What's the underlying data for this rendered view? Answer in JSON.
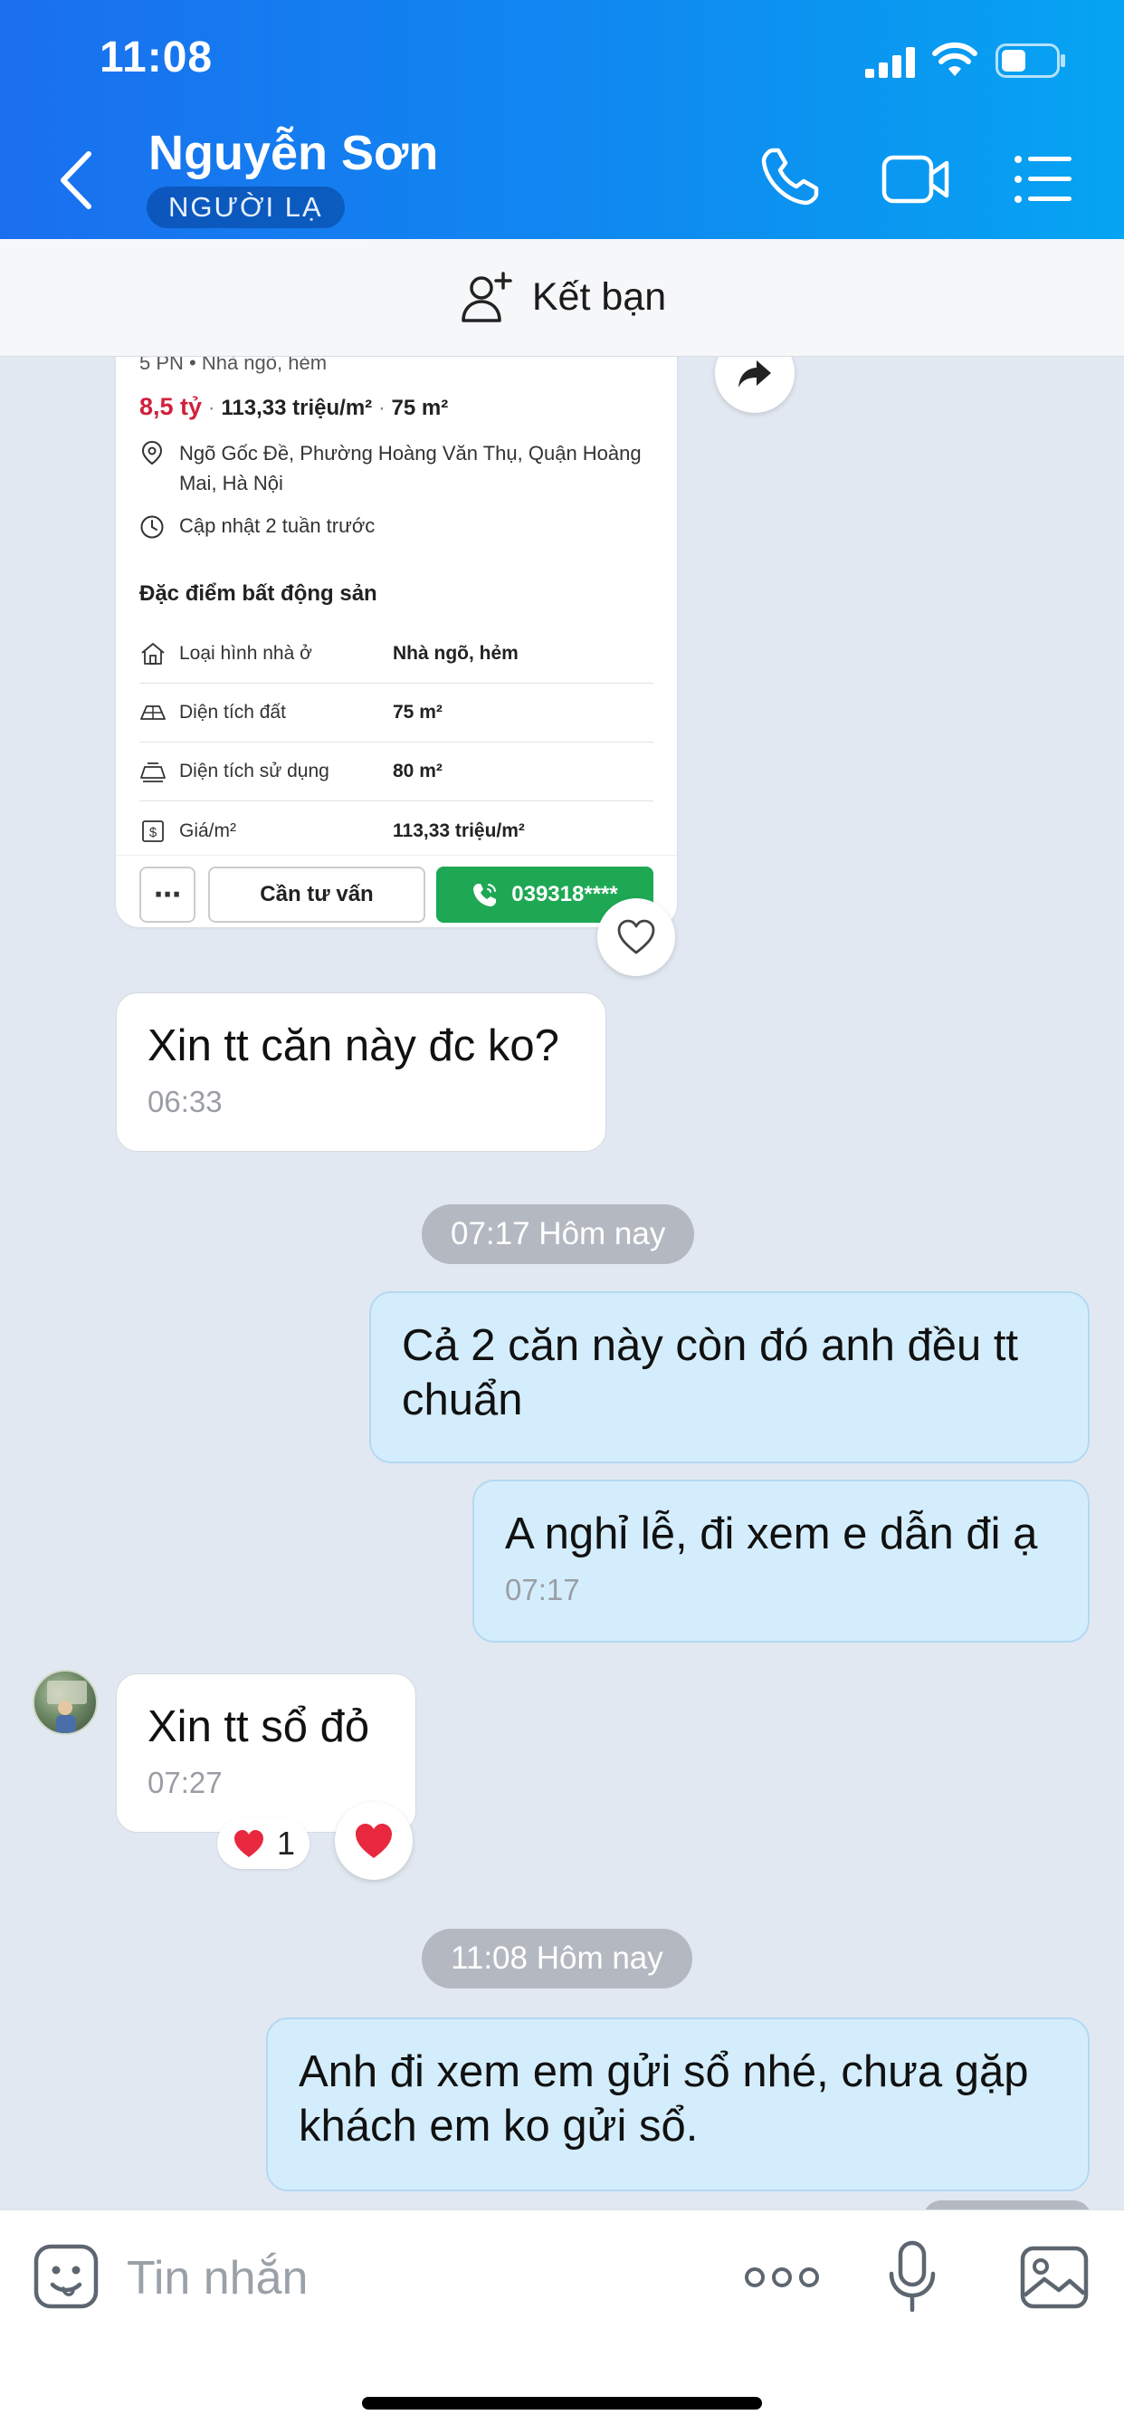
{
  "status_bar": {
    "time": "11:08"
  },
  "header": {
    "contact_name": "Nguyễn Sơn",
    "badge": "NGƯỜI LẠ",
    "background_colors": [
      "#1a6fef",
      "#06a4f2"
    ]
  },
  "friend_bar": {
    "label": "Kết bạn"
  },
  "listing_card": {
    "subtitle": "5 PN • Nhà ngõ, hẻm",
    "price": "8,5 tỷ",
    "price_per_m2": "113,33 triệu/m²",
    "area": "75 m²",
    "address": "Ngõ Gốc Đề, Phường Hoàng Văn Thụ, Quận Hoàng Mai, Hà Nội",
    "updated": "Cập nhật 2 tuần trước",
    "features_title": "Đặc điểm bất động sản",
    "features": [
      {
        "label": "Loại hình nhà ở",
        "value": "Nhà ngõ, hẻm",
        "icon": "house-type-icon"
      },
      {
        "label": "Diện tích đất",
        "value": "75 m²",
        "icon": "land-area-icon"
      },
      {
        "label": "Diện tích sử dụng",
        "value": "80 m²",
        "icon": "usable-area-icon"
      },
      {
        "label": "Giá/m²",
        "value": "113,33 triệu/m²",
        "icon": "price-icon"
      }
    ],
    "actions": {
      "more": "⋯",
      "consult": "Cần tư vấn",
      "phone": "039318****"
    },
    "price_color": "#d0213b",
    "phone_button_color": "#1ea854"
  },
  "messages": [
    {
      "direction": "in",
      "text": "Xin tt căn này đc ko?",
      "time": "06:33"
    },
    {
      "type": "date",
      "text": "07:17 Hôm nay"
    },
    {
      "direction": "out",
      "text": "Cả 2 căn này còn đó anh đều tt chuẩn",
      "time": ""
    },
    {
      "direction": "out",
      "text": "A nghỉ lễ, đi xem e dẫn đi ạ",
      "time": "07:17"
    },
    {
      "direction": "in",
      "text": "Xin tt sổ đỏ",
      "time": "07:27",
      "reaction_count": "1"
    },
    {
      "type": "date",
      "text": "11:08 Hôm nay"
    },
    {
      "direction": "out",
      "text": "Anh đi xem em gửi sổ nhé, chưa gặp khách em ko gửi sổ.",
      "time": ""
    }
  ],
  "input_bar": {
    "placeholder": "Tin nhắn"
  },
  "colors": {
    "chat_background": "#e2e8f1",
    "outgoing_bubble": "#d4edfc",
    "incoming_bubble": "#ffffff",
    "date_pill": "#b4b9c1",
    "heart": "#e8283e"
  }
}
